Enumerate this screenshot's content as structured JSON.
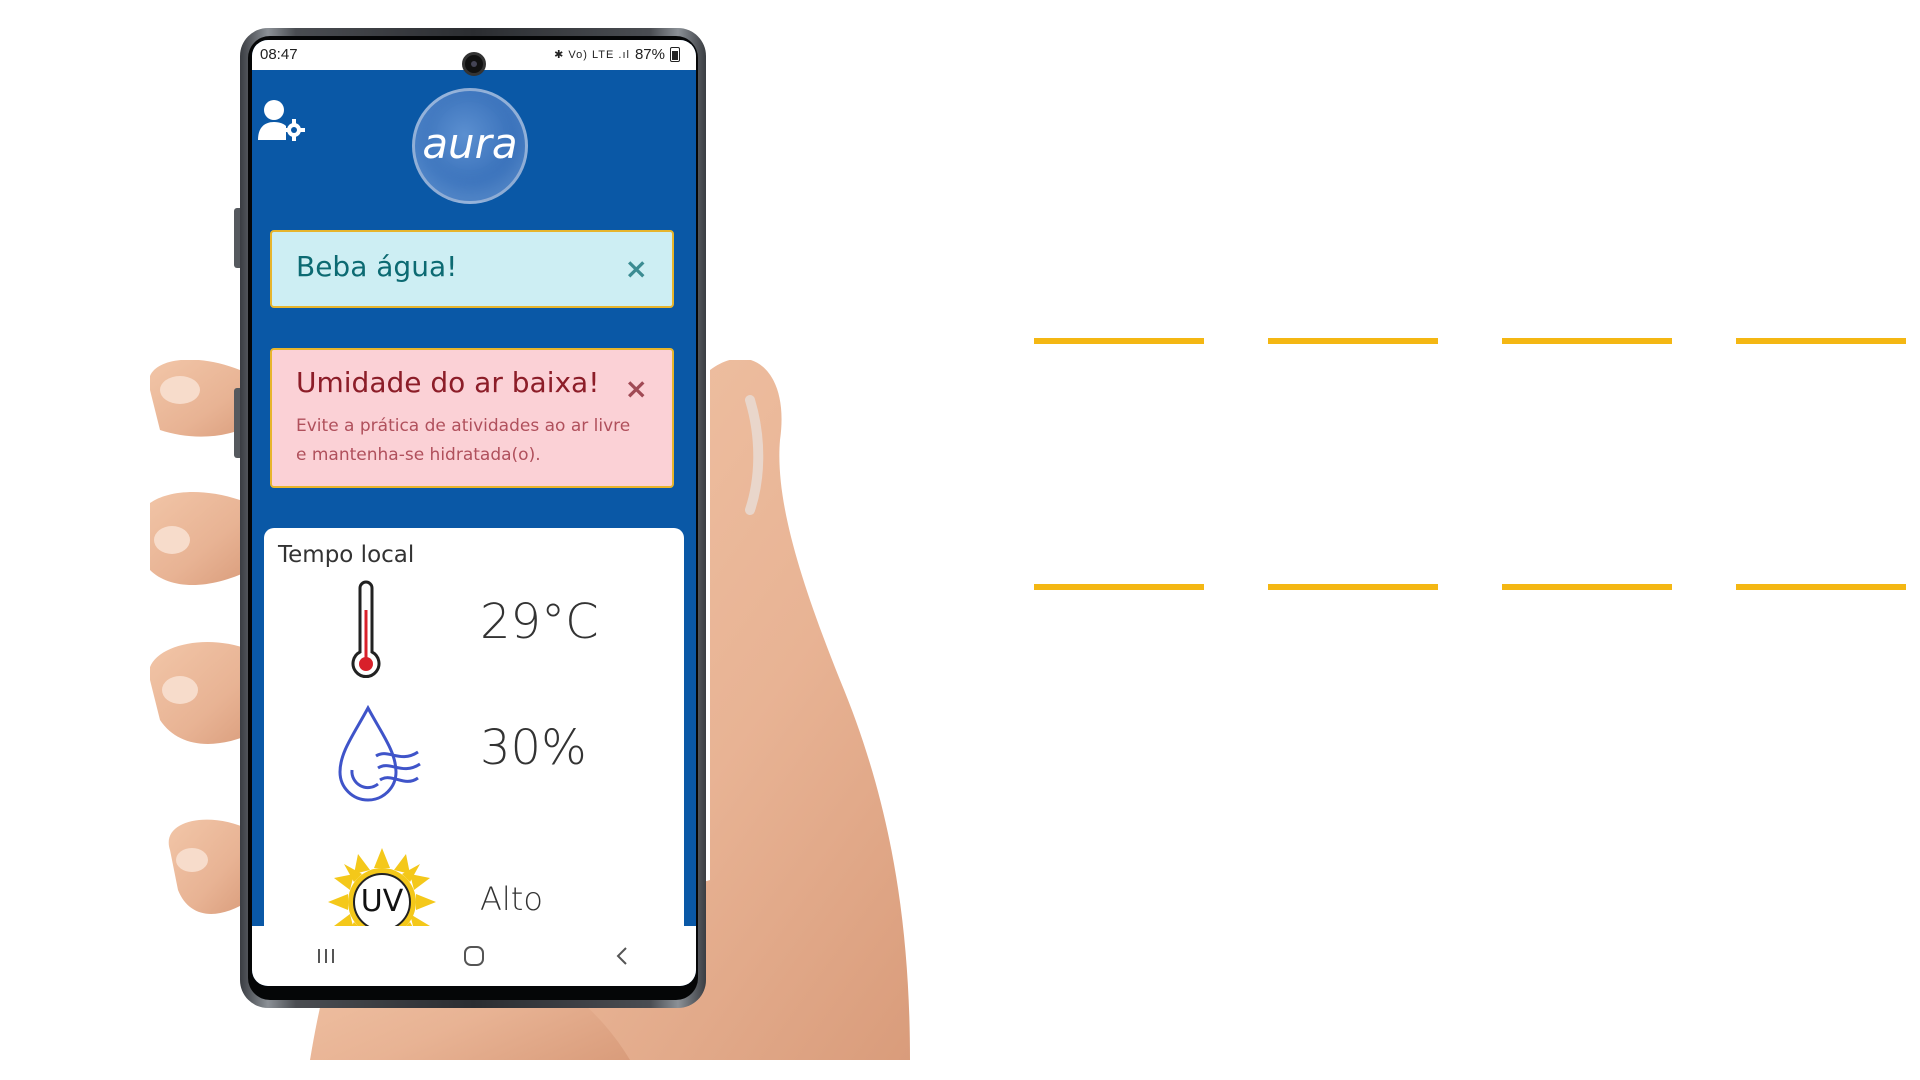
{
  "status": {
    "time": "08:47",
    "icons": "✱ Vo) LTE .ıl",
    "battery": "87%"
  },
  "app": {
    "logo_text": "aura"
  },
  "alerts": [
    {
      "title": "Beba água!",
      "close": "×"
    },
    {
      "title": "Umidade do ar baixa!",
      "body": "Evite a prática de atividades ao ar livre e mantenha-se hidratada(o).",
      "close": "×"
    }
  ],
  "weather": {
    "title": "Tempo local",
    "temperature": "29°C",
    "humidity": "30%",
    "uv_label": "UV",
    "uv_level": "Alto"
  },
  "icons": {
    "profile": "user-settings-icon",
    "temperature": "thermometer-icon",
    "humidity": "water-drop-icon",
    "uv": "sun-uv-icon",
    "nav": [
      "recent-apps-icon",
      "home-icon",
      "back-icon"
    ]
  },
  "colors": {
    "app_background": "#0a58a6",
    "info_bg": "#cdeef3",
    "danger_bg": "#fbd1d6",
    "accent": "#f4b713"
  }
}
